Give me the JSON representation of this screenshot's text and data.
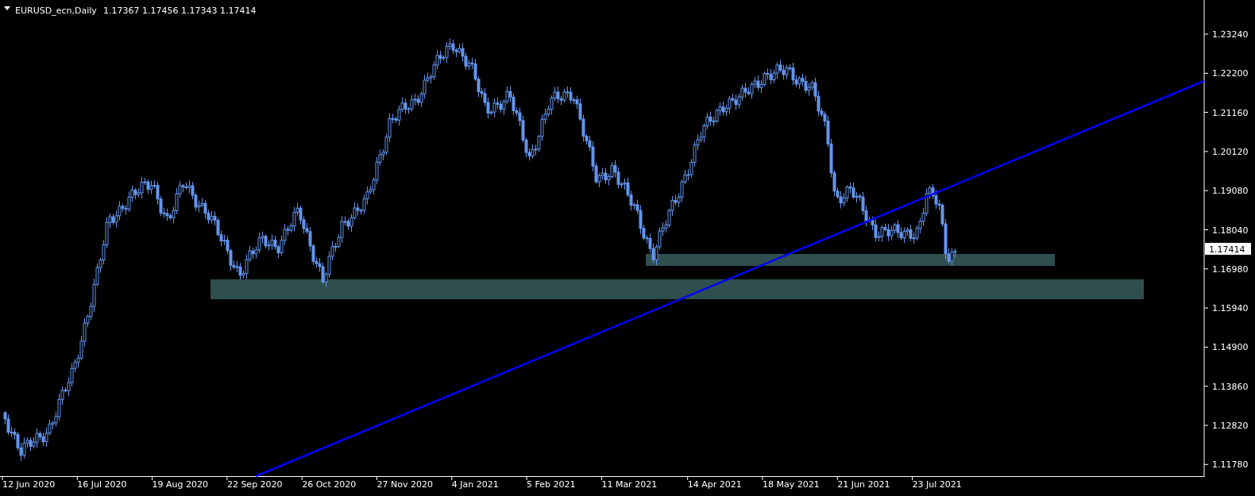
{
  "header": {
    "symbol": "EURUSD_ecn,Daily",
    "ohlc": "1.17367 1.17456 1.17343 1.17414"
  },
  "price_axis": {
    "labels": [
      "1.23240",
      "1.22200",
      "1.21160",
      "1.20120",
      "1.19080",
      "1.18040",
      "1.16980",
      "1.15940",
      "1.14900",
      "1.13860",
      "1.12820",
      "1.11780"
    ],
    "current_price": "1.17414"
  },
  "time_axis": {
    "labels": [
      "12 Jun 2020",
      "16 Jul 2020",
      "19 Aug 2020",
      "22 Sep 2020",
      "26 Oct 2020",
      "27 Nov 2020",
      "4 Jan 2021",
      "5 Feb 2021",
      "11 Mar 2021",
      "14 Apr 2021",
      "18 May 2021",
      "21 Jun 2021",
      "23 Jul 2021"
    ]
  }
}
